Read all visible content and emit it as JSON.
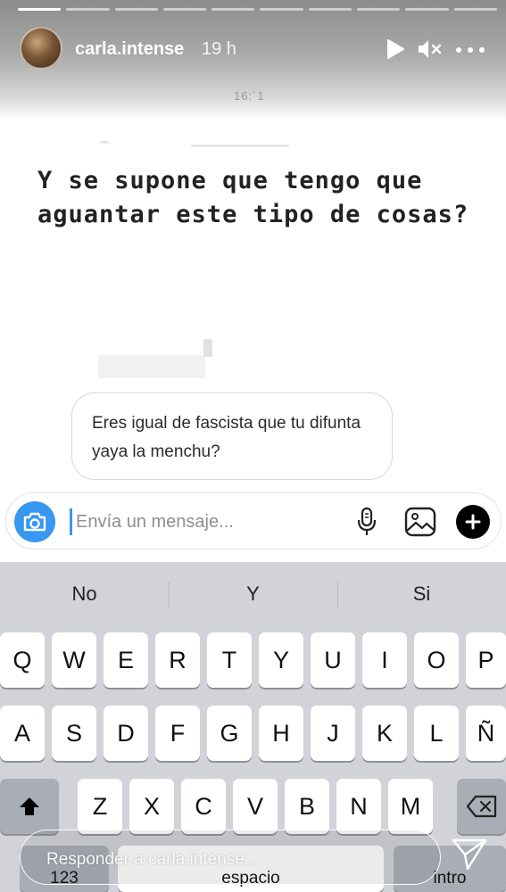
{
  "story": {
    "username": "carla.intense",
    "time_ago": "19 h",
    "progress_segments": 10,
    "progress_done": 1,
    "stamp": "16:´1"
  },
  "post": {
    "heading": "Y se supone que tengo que aguantar este tipo de cosas?",
    "message": "Eres igual de fascista que tu difunta yaya la menchu?"
  },
  "composer": {
    "placeholder": "Envía un mensaje...",
    "icons": [
      "camera-icon",
      "microphone-icon",
      "gallery-icon",
      "plus-icon"
    ]
  },
  "keyboard": {
    "suggestions": [
      "No",
      "Y",
      "Si"
    ],
    "row1": [
      "Q",
      "W",
      "E",
      "R",
      "T",
      "Y",
      "U",
      "I",
      "O",
      "P"
    ],
    "row2": [
      "A",
      "S",
      "D",
      "F",
      "G",
      "H",
      "J",
      "K",
      "L",
      "Ñ"
    ],
    "row3": [
      "Z",
      "X",
      "C",
      "V",
      "B",
      "N",
      "M"
    ],
    "numbers_label": "123",
    "space_label": "espacio",
    "return_label": "intro"
  },
  "reply": {
    "placeholder": "Responder a carla.intense..."
  },
  "colors": {
    "accent": "#3897f0",
    "keyboard_bg": "#d1d3d9"
  }
}
